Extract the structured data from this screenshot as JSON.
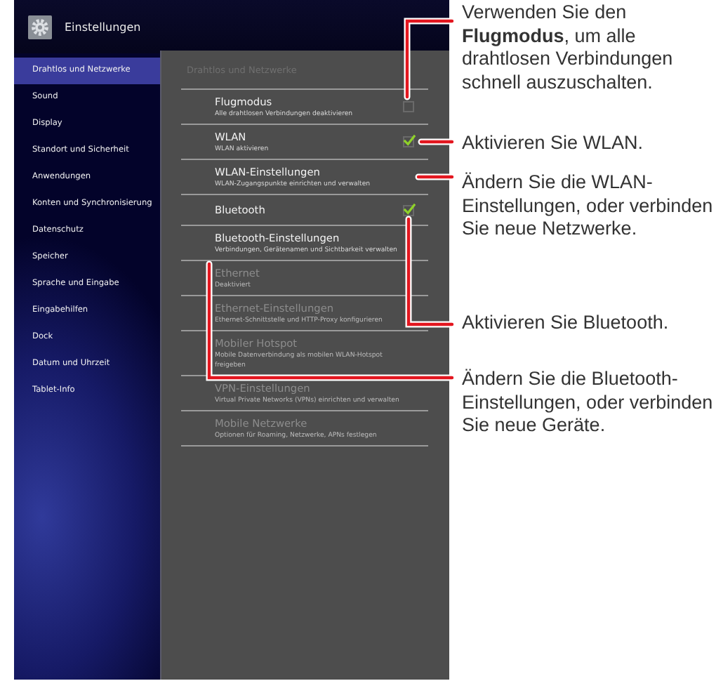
{
  "top_bar": {
    "title": "Einstellungen"
  },
  "sidebar": {
    "items": [
      {
        "label": "Drahtlos und Netzwerke",
        "selected": true
      },
      {
        "label": "Sound",
        "selected": false
      },
      {
        "label": "Display",
        "selected": false
      },
      {
        "label": "Standort und Sicherheit",
        "selected": false
      },
      {
        "label": "Anwendungen",
        "selected": false
      },
      {
        "label": "Konten und Synchronisierung",
        "selected": false
      },
      {
        "label": "Datenschutz",
        "selected": false
      },
      {
        "label": "Speicher",
        "selected": false
      },
      {
        "label": "Sprache und Eingabe",
        "selected": false
      },
      {
        "label": "Eingabehilfen",
        "selected": false
      },
      {
        "label": "Dock",
        "selected": false
      },
      {
        "label": "Datum und Uhrzeit",
        "selected": false
      },
      {
        "label": "Tablet-Info",
        "selected": false
      }
    ]
  },
  "panel": {
    "header": "Drahtlos und Netzwerke",
    "rows": [
      {
        "kind": "checkbox",
        "title": "Flugmodus",
        "subtitle": "Alle drahtlosen Verbindungen deaktivieren",
        "disabled": false,
        "checked": false
      },
      {
        "kind": "checkbox",
        "title": "WLAN",
        "subtitle": "WLAN aktivieren",
        "disabled": false,
        "checked": true
      },
      {
        "kind": "plain",
        "title": "WLAN-Einstellungen",
        "subtitle": "WLAN-Zugangspunkte einrichten und verwalten",
        "disabled": false
      },
      {
        "kind": "checkbox",
        "title": "Bluetooth",
        "disabled": false,
        "checked": true
      },
      {
        "kind": "plain",
        "title": "Bluetooth-Einstellungen",
        "subtitle": "Verbindungen, Gerätenamen und Sichtbarkeit verwalten",
        "disabled": false
      },
      {
        "kind": "plain",
        "title": "Ethernet",
        "subtitle": "Deaktiviert",
        "disabled": true
      },
      {
        "kind": "plain",
        "title": "Ethernet-Einstellungen",
        "subtitle": "Ethernet-Schnittstelle und HTTP-Proxy konfigurieren",
        "disabled": true
      },
      {
        "kind": "plain",
        "title": "Mobiler Hotspot",
        "subtitle": "Mobile Datenverbindung als mobilen WLAN-Hotspot freigeben",
        "disabled": true
      },
      {
        "kind": "plain",
        "title": "VPN-Einstellungen",
        "subtitle": "Virtual Private Networks (VPNs) einrichten und verwalten",
        "disabled": true
      },
      {
        "kind": "plain",
        "title": "Mobile Netzwerke",
        "subtitle": "Optionen für Roaming, Netzwerke, APNs festlegen",
        "disabled": true
      }
    ]
  },
  "callouts": [
    {
      "text": "Verwenden Sie den **Flugmodus**, um alle drahtlosen Verbindungen schnell auszuschalten."
    },
    {
      "text": "Aktivieren Sie WLAN."
    },
    {
      "text": "Ändern Sie die WLAN-Einstellungen, oder verbinden Sie neue Netzwerke."
    },
    {
      "text": "Aktivieren Sie Bluetooth."
    },
    {
      "text": "Ändern Sie die Bluetooth-Einstellungen, oder verbinden Sie neue Geräte."
    }
  ]
}
